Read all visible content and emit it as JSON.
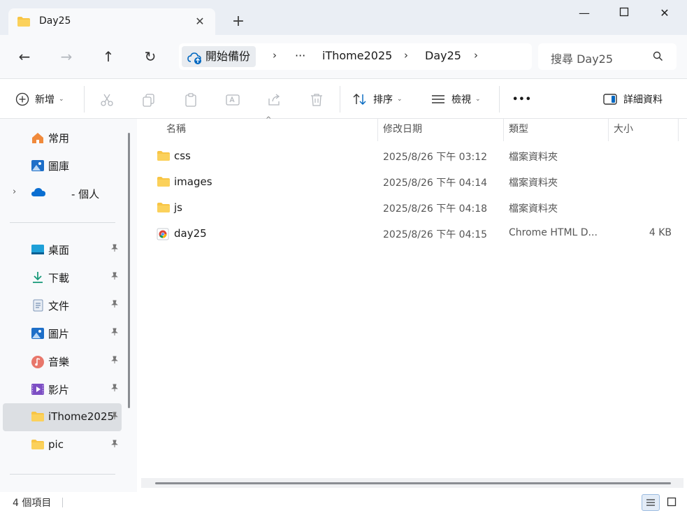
{
  "window": {
    "tab_title": "Day25",
    "new_tab_glyph": "+",
    "close_tab_glyph": "✕",
    "minimize_glyph": "—",
    "maximize_glyph": "☐",
    "close_glyph": "✕"
  },
  "navigation": {
    "back_glyph": "←",
    "forward_glyph": "→",
    "up_glyph": "↑",
    "refresh_glyph": "↻"
  },
  "breadcrumb": {
    "root": "開始備份",
    "ellipsis": "···",
    "items": [
      "iThome2025",
      "Day25"
    ],
    "separator": "›"
  },
  "search": {
    "placeholder": "搜尋 Day25"
  },
  "commandbar": {
    "new_label": "新增",
    "sort_label": "排序",
    "view_label": "檢視",
    "more_glyph": "•••",
    "details_label": "詳細資料",
    "caret": "⌄"
  },
  "sidebar": {
    "top": [
      {
        "label": "常用",
        "icon": "home-icon"
      },
      {
        "label": "圖庫",
        "icon": "gallery-icon"
      },
      {
        "label": "- 個人",
        "icon": "onedrive-cloud-icon"
      }
    ],
    "pinned": [
      {
        "label": "桌面",
        "icon": "desktop-icon"
      },
      {
        "label": "下載",
        "icon": "download-icon"
      },
      {
        "label": "文件",
        "icon": "document-icon"
      },
      {
        "label": "圖片",
        "icon": "pictures-icon"
      },
      {
        "label": "音樂",
        "icon": "music-icon"
      },
      {
        "label": "影片",
        "icon": "video-icon"
      },
      {
        "label": "iThome2025",
        "icon": "folder-icon",
        "selected": true
      },
      {
        "label": "pic",
        "icon": "folder-icon"
      }
    ],
    "pin_glyph": "📌",
    "expander_glyph": "›"
  },
  "columns": {
    "name": "名稱",
    "modified": "修改日期",
    "type": "類型",
    "size": "大小",
    "sort_glyph": "^"
  },
  "files": [
    {
      "name": "css",
      "modified": "2025/8/26 下午 03:12",
      "type": "檔案資料夾",
      "size": "",
      "icon": "folder-icon"
    },
    {
      "name": "images",
      "modified": "2025/8/26 下午 04:14",
      "type": "檔案資料夾",
      "size": "",
      "icon": "folder-icon"
    },
    {
      "name": "js",
      "modified": "2025/8/26 下午 04:18",
      "type": "檔案資料夾",
      "size": "",
      "icon": "folder-icon"
    },
    {
      "name": "day25",
      "modified": "2025/8/26 下午 04:15",
      "type": "Chrome HTML D...",
      "size": "4 KB",
      "icon": "chrome-html-icon"
    }
  ],
  "status": {
    "item_count": "4 個項目"
  },
  "colors": {
    "accent": "#0067c0",
    "folder": "#f8c545",
    "titlebar": "#eaeef4",
    "selected": "#dcdfe3"
  }
}
